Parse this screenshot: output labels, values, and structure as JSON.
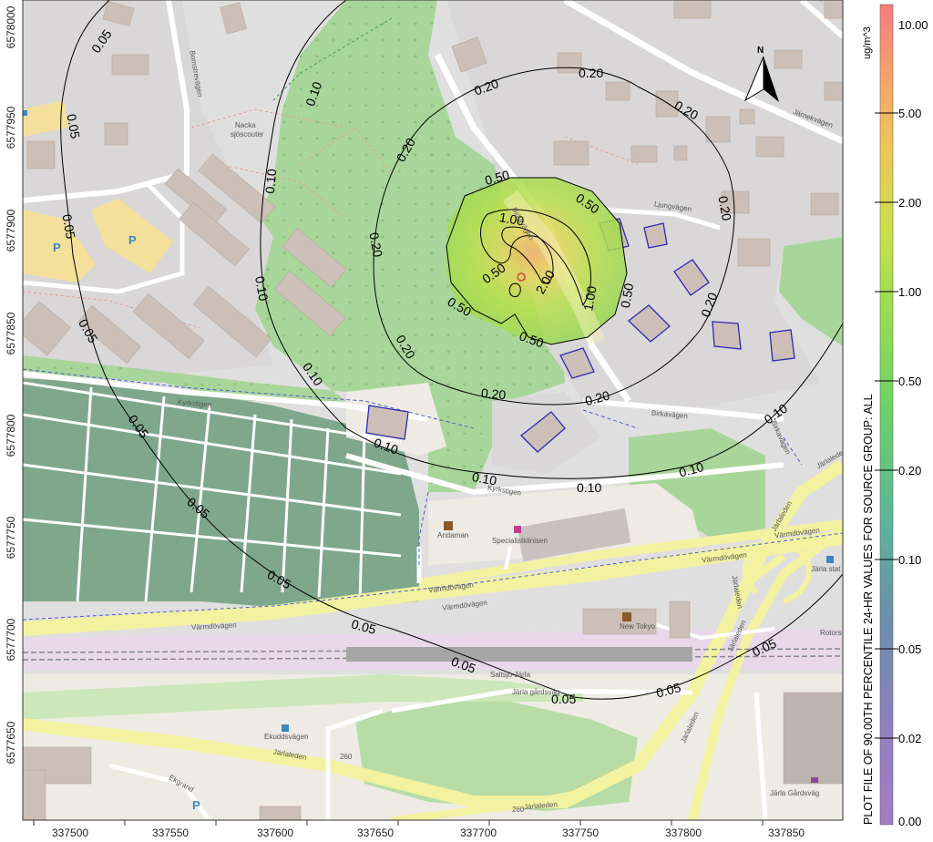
{
  "map": {
    "north_label": "N",
    "x_ticks": [
      "337500",
      "337550",
      "337600",
      "337650",
      "337700",
      "337750",
      "337800",
      "337850"
    ],
    "y_ticks": [
      "6578000",
      "6577950",
      "6577900",
      "6577850",
      "6577800",
      "6577750",
      "6577700",
      "6577650"
    ],
    "contour_labels": [
      "0.05",
      "0.10",
      "0.20",
      "0.50",
      "1.00",
      "2.00"
    ],
    "streets": {
      "varmdovagen": "Värmdövägen",
      "jarlaleden": "Järlaleden",
      "kyrkstigen": "Kyrkstigen",
      "birkavagen": "Birkavägen",
      "jarnek": "Järnekvägen",
      "ljung": "Ljungvägen",
      "bomstrav": "Bomstrevägen",
      "jarla_gardsvag": "Järla gårdsväg",
      "ekgrand": "Ekgrand"
    },
    "places": {
      "nacka": "Nacka",
      "sjoscouter": "sjöscouter",
      "andaman": "Andaman",
      "specialistklinisen": "Specialistklinisen",
      "new_tokyo": "New Tokyo",
      "saltsjo_jarla": "Saltsjö-Järla",
      "ekuddsvagen": "Ekuddsvägen",
      "jarla_gardsvag_place": "Järla Gårdsväg",
      "jarla_station": "Järla stat",
      "rotor": "Rotors"
    },
    "parking": "P",
    "route_260": "260"
  },
  "colorbar": {
    "unit": "ug/m^3",
    "title": "PLOT FILE OF 90.00TH PERCENTILE 24-HR VALUES FOR SOURCE GROUP: ALL",
    "tick_labels": [
      "10.00",
      "5.00",
      "2.00",
      "1.00",
      "0.50",
      "0.20",
      "0.10",
      "0.05",
      "0.02",
      "0.00"
    ],
    "colors": [
      "#f47d7d",
      "#f5b06a",
      "#e8d65a",
      "#b6e24d",
      "#6bd06a",
      "#5cb49a",
      "#6a8eaa",
      "#8f80c0",
      "#a57dc5"
    ]
  }
}
